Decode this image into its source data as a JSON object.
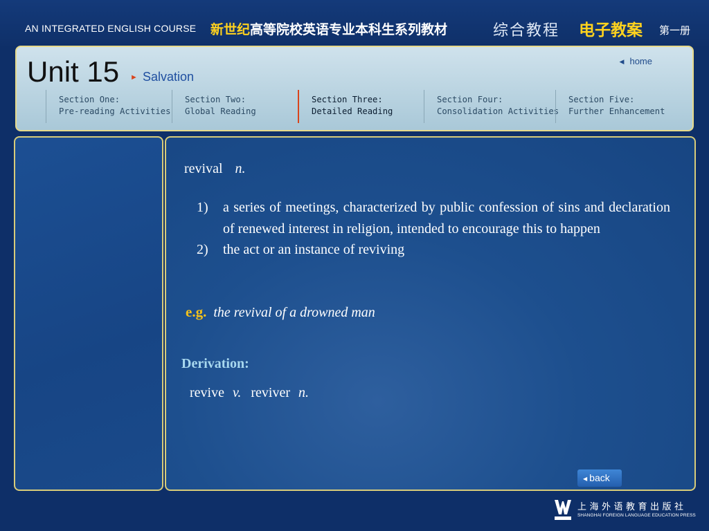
{
  "banner": {
    "course_name": "AN INTEGRATED ENGLISH COURSE",
    "series_highlight": "新世纪",
    "series_rest": "高等院校英语专业本科生系列教材",
    "course_cn": "综合教程",
    "plan_cn": "电子教案",
    "volume": "第一册"
  },
  "header": {
    "unit": "Unit 15",
    "unit_subtitle": "Salvation",
    "home_label": "home",
    "sections": [
      {
        "line1": "Section One:",
        "line2": "Pre-reading Activities",
        "active": false
      },
      {
        "line1": "Section Two:",
        "line2": "Global Reading",
        "active": false
      },
      {
        "line1": "Section Three:",
        "line2": "Detailed Reading",
        "active": true
      },
      {
        "line1": "Section Four:",
        "line2": "Consolidation Activities",
        "active": false
      },
      {
        "line1": "Section Five:",
        "line2": "Further Enhancement",
        "active": false
      }
    ]
  },
  "content": {
    "word": "revival",
    "pos": "n.",
    "definitions": [
      {
        "num": "1)",
        "text": "a series of meetings, characterized by public confession of sins and declaration of renewed interest in religion, intended to encourage this to happen"
      },
      {
        "num": "2)",
        "text": "the act or an instance of reviving"
      }
    ],
    "eg_label": "e.g.",
    "example": "the revival of a drowned man",
    "derivation_heading": "Derivation:",
    "derivation": {
      "word1": "revive",
      "pos1": "v.",
      "word2": "reviver",
      "pos2": "n."
    }
  },
  "nav": {
    "back_label": "back"
  },
  "publisher": {
    "cn_name": "上海外语教育出版社",
    "en_name": "SHANGHAI FOREIGN LANGUAGE EDUCATION PRESS"
  },
  "colors": {
    "background": "#0e2f68",
    "accent_yellow": "#ffd21e",
    "panel_border": "#d8cc7a",
    "active_section_marker": "#d9441c"
  }
}
